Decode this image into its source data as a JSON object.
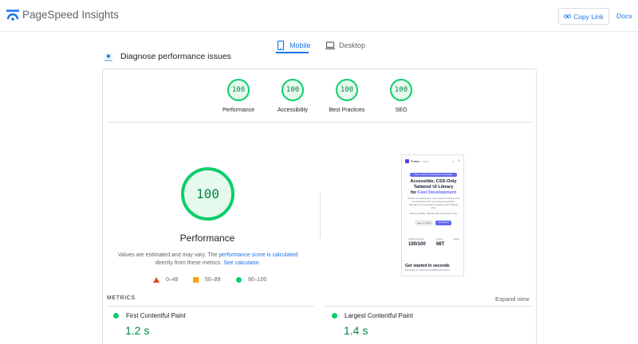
{
  "app": {
    "title": "PageSpeed Insights"
  },
  "header": {
    "copy_link_label": "Copy Link",
    "docs_label": "Docs"
  },
  "tabs": [
    {
      "label": "Mobile",
      "selected": true,
      "icon": "phone-icon"
    },
    {
      "label": "Desktop",
      "selected": false,
      "icon": "laptop-icon"
    }
  ],
  "diagnose": {
    "title": "Diagnose performance issues"
  },
  "categories": [
    {
      "score": "100",
      "label": "Performance"
    },
    {
      "score": "100",
      "label": "Accessibility"
    },
    {
      "score": "100",
      "label": "Best Practices"
    },
    {
      "score": "100",
      "label": "SEO"
    }
  ],
  "performance": {
    "score": "100",
    "title": "Performance",
    "note_prefix": "Values are estimated and may vary. The ",
    "note_link1": "performance score is calculated",
    "note_middle": " directly from these metrics. ",
    "note_link2": "See calculator."
  },
  "legend": [
    {
      "range": "0–49",
      "color": "#e64a19"
    },
    {
      "range": "50–89",
      "color": "#ffa400"
    },
    {
      "range": "90–100",
      "color": "#0cce6b"
    }
  ],
  "screenshot": {
    "brand": "Preline",
    "brand_badge": "docs",
    "pill": "Open-source UI components & templates",
    "headline_1": "Accessible, CSS-Only",
    "headline_2": "Tailwind UI Library",
    "headline_3_prefix": "for ",
    "headline_3_accent": "Fast Development",
    "body": "Preline is a leading free, open-source UI library built for developers who care about accessibility, standards, and seamless integration with Tailwind CSS.",
    "body_2": "CSS-compatible, SEO-friendly, and ready to use.",
    "btn_secondary": "View on GitHub",
    "btn_primary": "Get Started",
    "stat_1_label": "Lighthouse Score",
    "stat_1_value": "100/100",
    "stat_2_label": "License",
    "stat_2_value": "MIT",
    "stat_3_label": "Works",
    "subheading": "Get started in seconds",
    "subheading_body": "Everything you need to start building with Preline."
  },
  "metrics": {
    "title": "METRICS",
    "expand_label": "Expand view",
    "items": [
      {
        "name": "First Contentful Paint",
        "value": "1.2 s",
        "status_color": "#0cce6b"
      },
      {
        "name": "Largest Contentful Paint",
        "value": "1.4 s",
        "status_color": "#0cce6b"
      }
    ]
  },
  "colors": {
    "accent": "#1a73e8",
    "pass": "#0cce6b",
    "pass_text": "#018642"
  }
}
